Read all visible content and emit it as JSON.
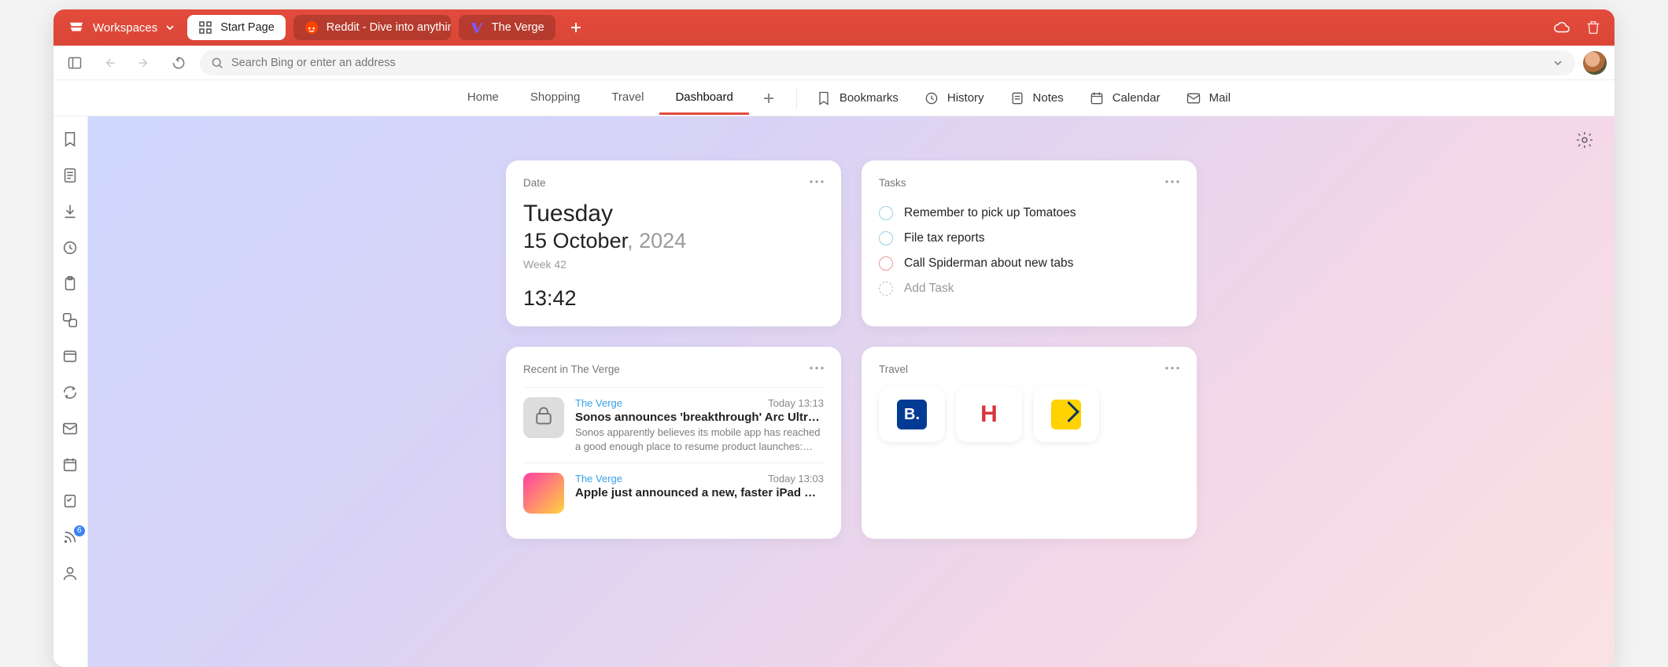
{
  "titlebar": {
    "workspaces_label": "Workspaces",
    "tabs": [
      {
        "label": "Start Page",
        "active": true
      },
      {
        "label": "Reddit - Dive into anything",
        "active": false
      },
      {
        "label": "The Verge",
        "active": false
      }
    ]
  },
  "addressbar": {
    "placeholder": "Search Bing or enter an address",
    "value": ""
  },
  "subnav": {
    "tabs": [
      {
        "label": "Home"
      },
      {
        "label": "Shopping"
      },
      {
        "label": "Travel"
      },
      {
        "label": "Dashboard",
        "active": true
      }
    ],
    "quick": [
      {
        "label": "Bookmarks"
      },
      {
        "label": "History"
      },
      {
        "label": "Notes"
      },
      {
        "label": "Calendar"
      },
      {
        "label": "Mail"
      }
    ]
  },
  "sidebar": {
    "feeds_badge": "6"
  },
  "dashboard": {
    "date": {
      "title": "Date",
      "day_of_week": "Tuesday",
      "date_part": "15 October",
      "year_part": ", 2024",
      "week": "Week 42",
      "time": "13:42"
    },
    "tasks": {
      "title": "Tasks",
      "items": [
        {
          "text": "Remember to pick up Tomatoes",
          "color": "blue"
        },
        {
          "text": "File tax reports",
          "color": "blue"
        },
        {
          "text": "Call Spiderman about new tabs",
          "color": "red"
        }
      ],
      "add_label": "Add Task"
    },
    "feed": {
      "title": "Recent in The Verge",
      "items": [
        {
          "source": "The Verge",
          "time": "Today 13:13",
          "headline": "Sonos announces 'breakthrough' Arc Ultra sou…",
          "desc": "Sonos apparently believes its mobile app has reached a good enough place to resume product launches: today…"
        },
        {
          "source": "The Verge",
          "time": "Today 13:03",
          "headline": "Apple just announced a new, faster iPad Mini",
          "desc": ""
        }
      ]
    },
    "travel": {
      "title": "Travel",
      "tiles": [
        {
          "name": "Booking.com",
          "glyph": "B."
        },
        {
          "name": "Hotels.com",
          "glyph": "H"
        },
        {
          "name": "Expedia",
          "glyph": ""
        }
      ]
    }
  }
}
